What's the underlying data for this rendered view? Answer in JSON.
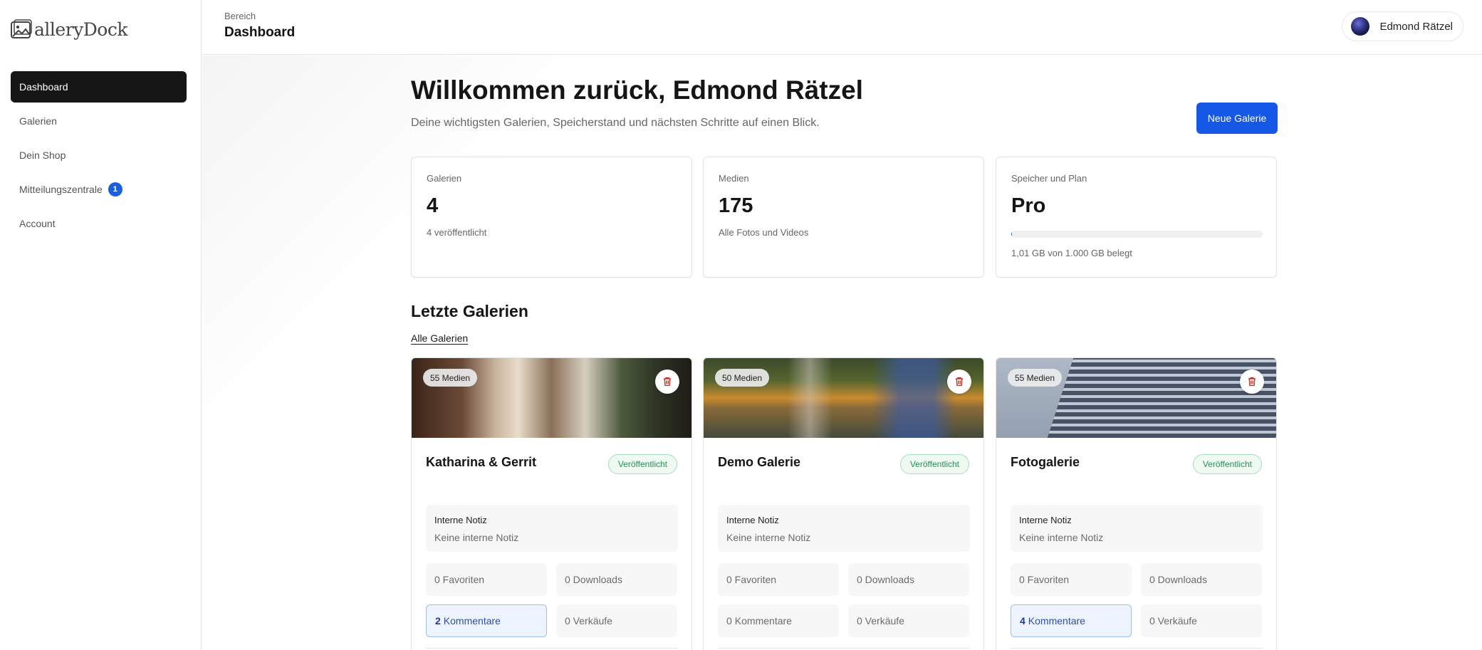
{
  "brand": {
    "logo_text": "alleryDock"
  },
  "sidebar": {
    "items": [
      {
        "label": "Dashboard",
        "active": true
      },
      {
        "label": "Galerien",
        "active": false
      },
      {
        "label": "Dein Shop",
        "active": false
      },
      {
        "label": "Mitteilungszentrale",
        "active": false,
        "badge": "1"
      },
      {
        "label": "Account",
        "active": false
      }
    ]
  },
  "header": {
    "section_label": "Bereich",
    "title": "Dashboard",
    "user_name": "Edmond Rätzel"
  },
  "main": {
    "welcome": "Willkommen zurück, Edmond Rätzel",
    "subtitle": "Deine wichtigsten Galerien, Speicherstand und nächsten Schritte auf einen Blick.",
    "new_gallery_button": "Neue Galerie",
    "stats": [
      {
        "label": "Galerien",
        "value": "4",
        "note": "4 veröffentlicht"
      },
      {
        "label": "Medien",
        "value": "175",
        "note": "Alle Fotos und Videos"
      },
      {
        "label": "Speicher und Plan",
        "value": "Pro",
        "note": "1,01 GB von 1.000 GB belegt",
        "usage_fraction": 0.001
      }
    ],
    "recent_title": "Letzte Galerien",
    "all_link": "Alle Galerien"
  },
  "galleries": [
    {
      "media_chip": "55 Medien",
      "title": "Katharina & Gerrit",
      "status": "Veröffentlicht",
      "note_title": "Interne Notiz",
      "note_text": "Keine interne Notiz",
      "favorites": "0 Favoriten",
      "downloads": "0 Downloads",
      "comments_count": "2",
      "comments_label": "Kommentare",
      "sales": "0 Verkäufe"
    },
    {
      "media_chip": "50 Medien",
      "title": "Demo Galerie",
      "status": "Veröffentlicht",
      "note_title": "Interne Notiz",
      "note_text": "Keine interne Notiz",
      "favorites": "0 Favoriten",
      "downloads": "0 Downloads",
      "comments_count": "0",
      "comments_label": "Kommentare",
      "sales": "0 Verkäufe"
    },
    {
      "media_chip": "55 Medien",
      "title": "Fotogalerie",
      "status": "Veröffentlicht",
      "note_title": "Interne Notiz",
      "note_text": "Keine interne Notiz",
      "favorites": "0 Favoriten",
      "downloads": "0 Downloads",
      "comments_count": "4",
      "comments_label": "Kommentare",
      "sales": "0 Verkäufe"
    }
  ],
  "colors": {
    "accent": "#1558e8",
    "sidebar_active": "#161616",
    "published_green": "#2a8f58",
    "trash_red": "#c0392b"
  },
  "icons": [
    "gallery-logo-icon",
    "trash-icon",
    "avatar"
  ]
}
